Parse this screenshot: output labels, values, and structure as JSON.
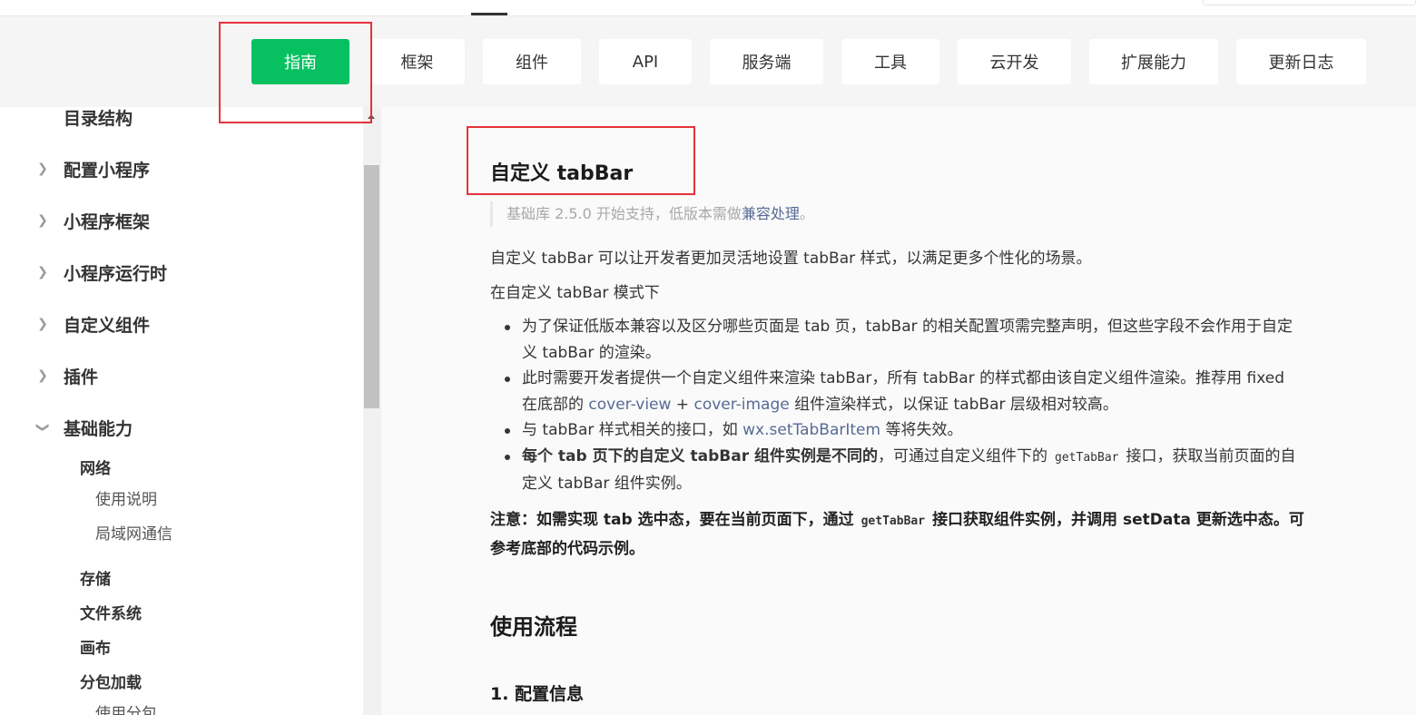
{
  "header": {
    "tabs": [
      {
        "label": "指南",
        "active": true
      },
      {
        "label": "框架"
      },
      {
        "label": "组件"
      },
      {
        "label": "API"
      },
      {
        "label": "服务端"
      },
      {
        "label": "工具"
      },
      {
        "label": "云开发"
      },
      {
        "label": "扩展能力"
      },
      {
        "label": "更新日志"
      }
    ],
    "accent_color": "#07c160"
  },
  "sidebar": {
    "top_item": "目录结构",
    "items": [
      {
        "label": "配置小程序",
        "expanded": false
      },
      {
        "label": "小程序框架",
        "expanded": false
      },
      {
        "label": "小程序运行时",
        "expanded": false
      },
      {
        "label": "自定义组件",
        "expanded": false
      },
      {
        "label": "插件",
        "expanded": false
      },
      {
        "label": "基础能力",
        "expanded": true
      }
    ],
    "sub": {
      "network": "网络",
      "network_usage": "使用说明",
      "lan": "局域网通信",
      "storage": "存储",
      "fs": "文件系统",
      "canvas": "画布",
      "subpkg": "分包加载",
      "subpkg_use": "使用分包"
    }
  },
  "main": {
    "title": "自定义 tabBar",
    "note_prefix": "基础库 2.5.0 开始支持，低版本需做",
    "note_link": "兼容处理",
    "note_suffix": "。",
    "intro": "自定义 tabBar 可以让开发者更加灵活地设置 tabBar 样式，以满足更多个性化的场景。",
    "mode": "在自定义 tabBar 模式下",
    "bullets": {
      "b1": "为了保证低版本兼容以及区分哪些页面是 tab 页，tabBar 的相关配置项需完整声明，但这些字段不会作用于自定义 tabBar 的渲染。",
      "b2_a": "此时需要开发者提供一个自定义组件来渲染 tabBar，所有 tabBar 的样式都由该自定义组件渲染。推荐用 fixed 在底部的 ",
      "b2_link1": "cover-view",
      "b2_plus": " + ",
      "b2_link2": "cover-image",
      "b2_b": " 组件渲染样式，以保证 tabBar 层级相对较高。",
      "b3_a": "与 tabBar 样式相关的接口，如 ",
      "b3_link": "wx.setTabBarItem",
      "b3_b": " 等将失效。",
      "b4_bold": "每个 tab 页下的自定义 tabBar 组件实例是不同的",
      "b4_a": "，可通过自定义组件下的",
      "b4_code": "getTabBar",
      "b4_b": "接口，获取当前页面的自定义 tabBar 组件实例。"
    },
    "warn_a": "注意：如需实现 tab 选中态，要在当前页面下，通过",
    "warn_code": "getTabBar",
    "warn_b": "接口获取组件实例，并调用 setData 更新选中态。可参考底部的代码示例。",
    "section_title": "使用流程",
    "step_title": "1. 配置信息"
  }
}
